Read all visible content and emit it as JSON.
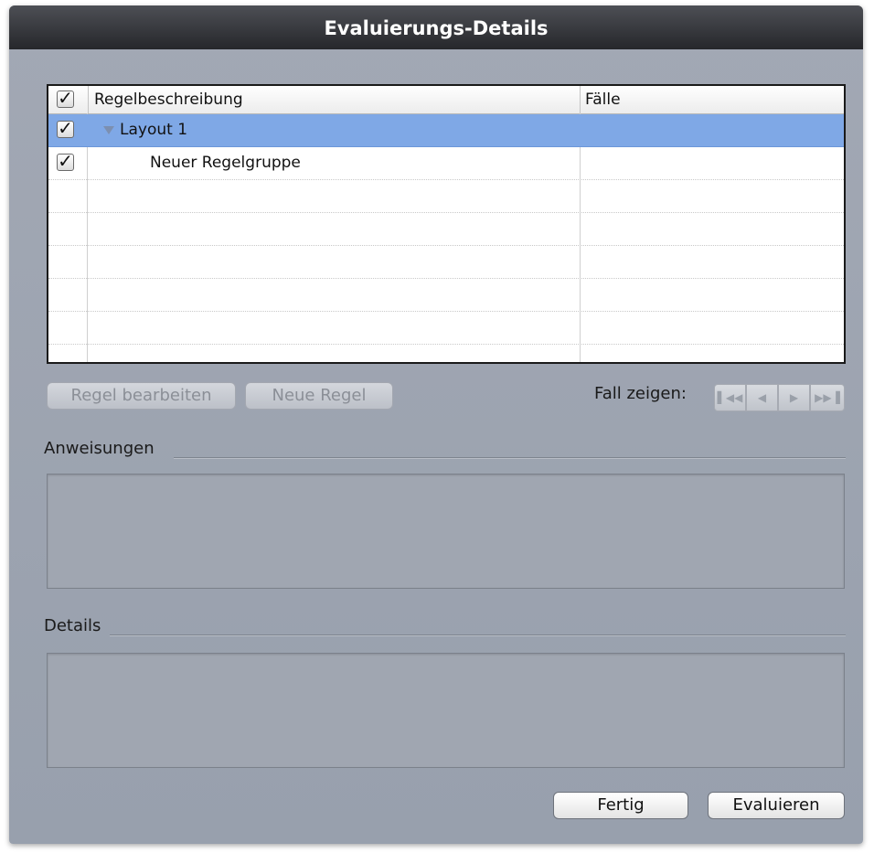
{
  "window": {
    "title": "Evaluierungs-Details"
  },
  "table": {
    "headers": {
      "check": "✓",
      "description": "Regelbeschreibung",
      "cases": "Fälle"
    },
    "rows": [
      {
        "checked": true,
        "label": "Layout 1",
        "cases": "",
        "expanded": true,
        "selected": true
      },
      {
        "checked": true,
        "label": "Neuer Regelgruppe",
        "cases": "",
        "selected": false
      }
    ]
  },
  "buttons": {
    "edit_rule": "Regel bearbeiten",
    "new_rule": "Neue Regel",
    "done": "Fertig",
    "evaluate": "Evaluieren"
  },
  "case_nav": {
    "label": "Fall zeigen:",
    "first_icon": "first-icon",
    "prev_icon": "prev-icon",
    "next_icon": "next-icon",
    "last_icon": "last-icon"
  },
  "sections": {
    "instructions_label": "Anweisungen",
    "details_label": "Details",
    "instructions_text": "",
    "details_text": ""
  },
  "colors": {
    "selection": "#7fa8e6",
    "window_bg": "#9ea5b1",
    "titlebar": "#2e2f33"
  }
}
